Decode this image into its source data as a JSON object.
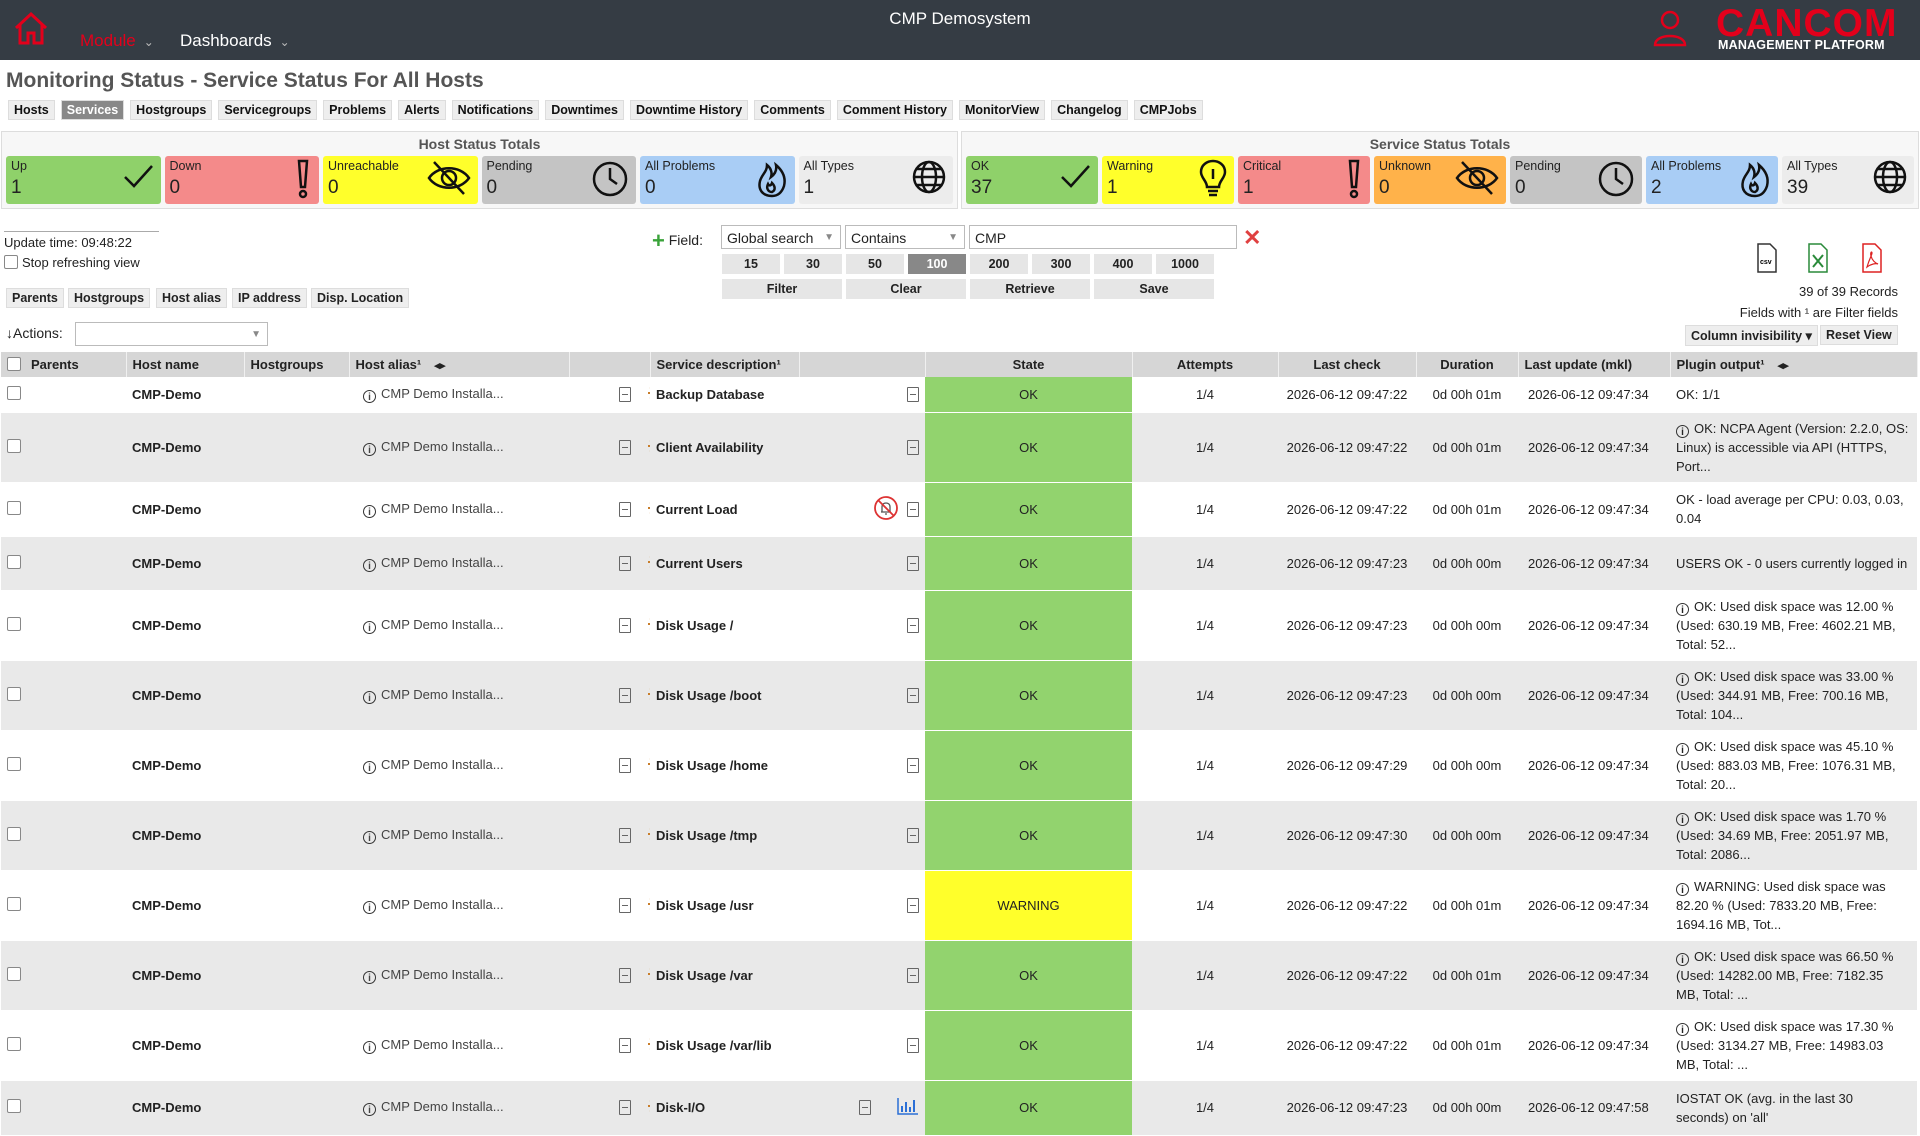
{
  "topbar": {
    "title": "CMP Demosystem",
    "menu_module": "Module",
    "menu_dashboards": "Dashboards",
    "brand": "CANCOM",
    "brand_sub": "MANAGEMENT PLATFORM"
  },
  "page_title": "Monitoring Status - Service Status For All Hosts",
  "tabs": [
    "Hosts",
    "Services",
    "Hostgroups",
    "Servicegroups",
    "Problems",
    "Alerts",
    "Notifications",
    "Downtimes",
    "Downtime History",
    "Comments",
    "Comment History",
    "MonitorView",
    "Changelog",
    "CMPJobs"
  ],
  "active_tab": "Services",
  "host_totals": {
    "title": "Host Status Totals",
    "cards": [
      {
        "label": "Up",
        "value": "1",
        "color": "#8fd16a",
        "icon": "check-icon"
      },
      {
        "label": "Down",
        "value": "0",
        "color": "#f48a8a",
        "icon": "exclamation-icon"
      },
      {
        "label": "Unreachable",
        "value": "0",
        "color": "#ffff2b",
        "icon": "eye-slash-icon"
      },
      {
        "label": "Pending",
        "value": "0",
        "color": "#c4c4c4",
        "icon": "clock-icon"
      },
      {
        "label": "All Problems",
        "value": "0",
        "color": "#a9cdf5",
        "icon": "fire-icon"
      },
      {
        "label": "All Types",
        "value": "1",
        "color": "#ececec",
        "icon": "globe-icon"
      }
    ]
  },
  "service_totals": {
    "title": "Service Status Totals",
    "cards": [
      {
        "label": "OK",
        "value": "37",
        "color": "#8fd16a",
        "icon": "check-icon"
      },
      {
        "label": "Warning",
        "value": "1",
        "color": "#ffff2b",
        "icon": "bulb-icon"
      },
      {
        "label": "Critical",
        "value": "1",
        "color": "#f48a8a",
        "icon": "exclamation-icon"
      },
      {
        "label": "Unknown",
        "value": "0",
        "color": "#ffb24a",
        "icon": "eye-slash-icon"
      },
      {
        "label": "Pending",
        "value": "0",
        "color": "#c4c4c4",
        "icon": "clock-icon"
      },
      {
        "label": "All Problems",
        "value": "2",
        "color": "#a9cdf5",
        "icon": "fire-icon"
      },
      {
        "label": "All Types",
        "value": "39",
        "color": "#ececec",
        "icon": "globe-icon"
      }
    ]
  },
  "update": {
    "text": "Update time: 09:48:22",
    "stop": "Stop refreshing view"
  },
  "filter": {
    "field_label": "Field:",
    "field_value": "Global search",
    "op_value": "Contains",
    "search_value": "CMP",
    "page_sizes": [
      "15",
      "30",
      "50",
      "100",
      "200",
      "300",
      "400",
      "1000"
    ],
    "active_page_size": "100",
    "buttons": [
      "Filter",
      "Clear",
      "Retrieve",
      "Save"
    ]
  },
  "export": {
    "csv": "csv",
    "records": "39 of 39 Records",
    "fields_note": "Fields with ¹ are Filter fields",
    "col_invis": "Column invisibility",
    "reset": "Reset View"
  },
  "column_toggles": [
    "Parents",
    "Hostgroups",
    "Host alias",
    "IP address",
    "Disp. Location"
  ],
  "actions_label": "Actions:",
  "columns": [
    "Parents",
    "Host name",
    "Hostgroups",
    "Host alias¹",
    "",
    "Service description¹",
    "",
    "State",
    "Attempts",
    "Last check",
    "Duration",
    "Last update (mkl)",
    "Plugin output¹"
  ],
  "rows": [
    {
      "host": "CMP-Demo",
      "alias": "CMP Demo Installa...",
      "service": "Backup Database",
      "state": "OK",
      "attempts": "1/4",
      "last_check": "2026-06-12 09:47:22",
      "duration": "0d 00h 01m",
      "last_update": "2026-06-12 09:47:34",
      "output": "OK: 1/1",
      "info": false
    },
    {
      "host": "CMP-Demo",
      "alias": "CMP Demo Installa...",
      "service": "Client Availability",
      "state": "OK",
      "attempts": "1/4",
      "last_check": "2026-06-12 09:47:22",
      "duration": "0d 00h 01m",
      "last_update": "2026-06-12 09:47:34",
      "output": "OK: NCPA Agent (Version: 2.2.0, OS: Linux) is accessible via API (HTTPS, Port...",
      "info": true
    },
    {
      "host": "CMP-Demo",
      "alias": "CMP Demo Installa...",
      "service": "Current Load",
      "state": "OK",
      "attempts": "1/4",
      "last_check": "2026-06-12 09:47:22",
      "duration": "0d 00h 01m",
      "last_update": "2026-06-12 09:47:34",
      "output": "OK - load average per CPU: 0.03, 0.03, 0.04",
      "info": false
    },
    {
      "host": "CMP-Demo",
      "alias": "CMP Demo Installa...",
      "service": "Current Users",
      "state": "OK",
      "attempts": "1/4",
      "last_check": "2026-06-12 09:47:23",
      "duration": "0d 00h 00m",
      "last_update": "2026-06-12 09:47:34",
      "output": "USERS OK - 0 users currently logged in",
      "info": false
    },
    {
      "host": "CMP-Demo",
      "alias": "CMP Demo Installa...",
      "service": "Disk Usage /",
      "state": "OK",
      "attempts": "1/4",
      "last_check": "2026-06-12 09:47:23",
      "duration": "0d 00h 00m",
      "last_update": "2026-06-12 09:47:34",
      "output": "OK: Used disk space was 12.00 % (Used: 630.19 MB, Free: 4602.21 MB, Total: 52...",
      "info": true
    },
    {
      "host": "CMP-Demo",
      "alias": "CMP Demo Installa...",
      "service": "Disk Usage /boot",
      "state": "OK",
      "attempts": "1/4",
      "last_check": "2026-06-12 09:47:23",
      "duration": "0d 00h 00m",
      "last_update": "2026-06-12 09:47:34",
      "output": "OK: Used disk space was 33.00 % (Used: 344.91 MB, Free: 700.16 MB, Total: 104...",
      "info": true
    },
    {
      "host": "CMP-Demo",
      "alias": "CMP Demo Installa...",
      "service": "Disk Usage /home",
      "state": "OK",
      "attempts": "1/4",
      "last_check": "2026-06-12 09:47:29",
      "duration": "0d 00h 00m",
      "last_update": "2026-06-12 09:47:34",
      "output": "OK: Used disk space was 45.10 % (Used: 883.03 MB, Free: 1076.31 MB, Total: 20...",
      "info": true
    },
    {
      "host": "CMP-Demo",
      "alias": "CMP Demo Installa...",
      "service": "Disk Usage /tmp",
      "state": "OK",
      "attempts": "1/4",
      "last_check": "2026-06-12 09:47:30",
      "duration": "0d 00h 00m",
      "last_update": "2026-06-12 09:47:34",
      "output": "OK: Used disk space was 1.70 % (Used: 34.69 MB, Free: 2051.97 MB, Total: 2086...",
      "info": true
    },
    {
      "host": "CMP-Demo",
      "alias": "CMP Demo Installa...",
      "service": "Disk Usage /usr",
      "state": "WARNING",
      "attempts": "1/4",
      "last_check": "2026-06-12 09:47:22",
      "duration": "0d 00h 01m",
      "last_update": "2026-06-12 09:47:34",
      "output": "WARNING: Used disk space was 82.20 % (Used: 7833.20 MB, Free: 1694.16 MB, Tot...",
      "info": true
    },
    {
      "host": "CMP-Demo",
      "alias": "CMP Demo Installa...",
      "service": "Disk Usage /var",
      "state": "OK",
      "attempts": "1/4",
      "last_check": "2026-06-12 09:47:22",
      "duration": "0d 00h 01m",
      "last_update": "2026-06-12 09:47:34",
      "output": "OK: Used disk space was 66.50 % (Used: 14282.00 MB, Free: 7182.35 MB, Total: ...",
      "info": true
    },
    {
      "host": "CMP-Demo",
      "alias": "CMP Demo Installa...",
      "service": "Disk Usage /var/lib",
      "state": "OK",
      "attempts": "1/4",
      "last_check": "2026-06-12 09:47:22",
      "duration": "0d 00h 01m",
      "last_update": "2026-06-12 09:47:34",
      "output": "OK: Used disk space was 17.30 % (Used: 3134.27 MB, Free: 14983.03 MB, Total: ...",
      "info": true
    },
    {
      "host": "CMP-Demo",
      "alias": "CMP Demo Installa...",
      "service": "Disk-I/O",
      "state": "OK",
      "attempts": "1/4",
      "last_check": "2026-06-12 09:47:23",
      "duration": "0d 00h 00m",
      "last_update": "2026-06-12 09:47:58",
      "output": "IOSTAT OK (avg. in the last 30 seconds) on 'all'",
      "info": false
    }
  ]
}
